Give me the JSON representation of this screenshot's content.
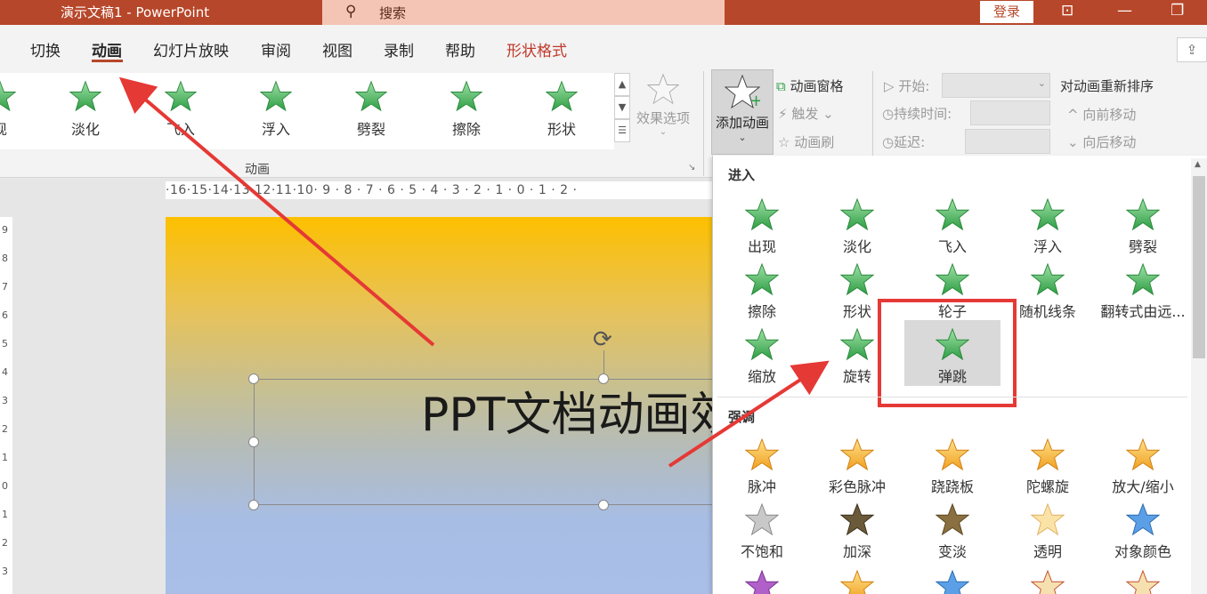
{
  "window": {
    "title": "演示文稿1  -  PowerPoint",
    "search_placeholder": "搜索",
    "login": "登录"
  },
  "tabs": [
    {
      "label": "切换"
    },
    {
      "label": "动画"
    },
    {
      "label": "幻灯片放映"
    },
    {
      "label": "审阅"
    },
    {
      "label": "视图"
    },
    {
      "label": "录制"
    },
    {
      "label": "帮助"
    },
    {
      "label": "形状格式"
    }
  ],
  "gallery": {
    "items": [
      {
        "label": "现"
      },
      {
        "label": "淡化"
      },
      {
        "label": "飞入"
      },
      {
        "label": "浮入"
      },
      {
        "label": "劈裂"
      },
      {
        "label": "擦除"
      },
      {
        "label": "形状"
      }
    ],
    "effect_options": "效果选项",
    "group_label": "动画"
  },
  "advanced": {
    "add_animation": "添加动画",
    "animation_pane": "动画窗格",
    "trigger": "触发",
    "painter": "动画刷"
  },
  "timing": {
    "start": "开始:",
    "duration": "持续时间:",
    "delay": "延迟:",
    "reorder_title": "对动画重新排序",
    "move_earlier": "向前移动",
    "move_later": "向后移动"
  },
  "ruler": {
    "h_ticks": "·16·15·14·13·12·11·10· 9 · 8 · 7 · 6 · 5 · 4 · 3 · 2 · 1 · 0 · 1 · 2 ·",
    "v_ticks": [
      "9",
      "8",
      "7",
      "6",
      "5",
      "4",
      "3",
      "2",
      "1",
      "0",
      "1",
      "2",
      "3"
    ]
  },
  "slide": {
    "text": "PPT文档动画效"
  },
  "panel": {
    "entrance_title": "进入",
    "entrance": [
      {
        "label": "出现"
      },
      {
        "label": "淡化"
      },
      {
        "label": "飞入"
      },
      {
        "label": "浮入"
      },
      {
        "label": "劈裂"
      },
      {
        "label": "擦除"
      },
      {
        "label": "形状"
      },
      {
        "label": "轮子"
      },
      {
        "label": "随机线条"
      },
      {
        "label": "翻转式由远..."
      },
      {
        "label": "缩放"
      },
      {
        "label": "旋转"
      },
      {
        "label": "弹跳"
      }
    ],
    "emphasis_title": "强调",
    "emphasis": [
      {
        "label": "脉冲"
      },
      {
        "label": "彩色脉冲"
      },
      {
        "label": "跷跷板"
      },
      {
        "label": "陀螺旋"
      },
      {
        "label": "放大/缩小"
      },
      {
        "label": "不饱和"
      },
      {
        "label": "加深"
      },
      {
        "label": "变淡"
      },
      {
        "label": "透明"
      },
      {
        "label": "对象颜色"
      }
    ],
    "selected": "弹跳"
  },
  "colors": {
    "accent": "#b7472a",
    "entrance_star": "#4caf50",
    "emphasis_star": "#f5b335",
    "highlight": "#e53935"
  }
}
